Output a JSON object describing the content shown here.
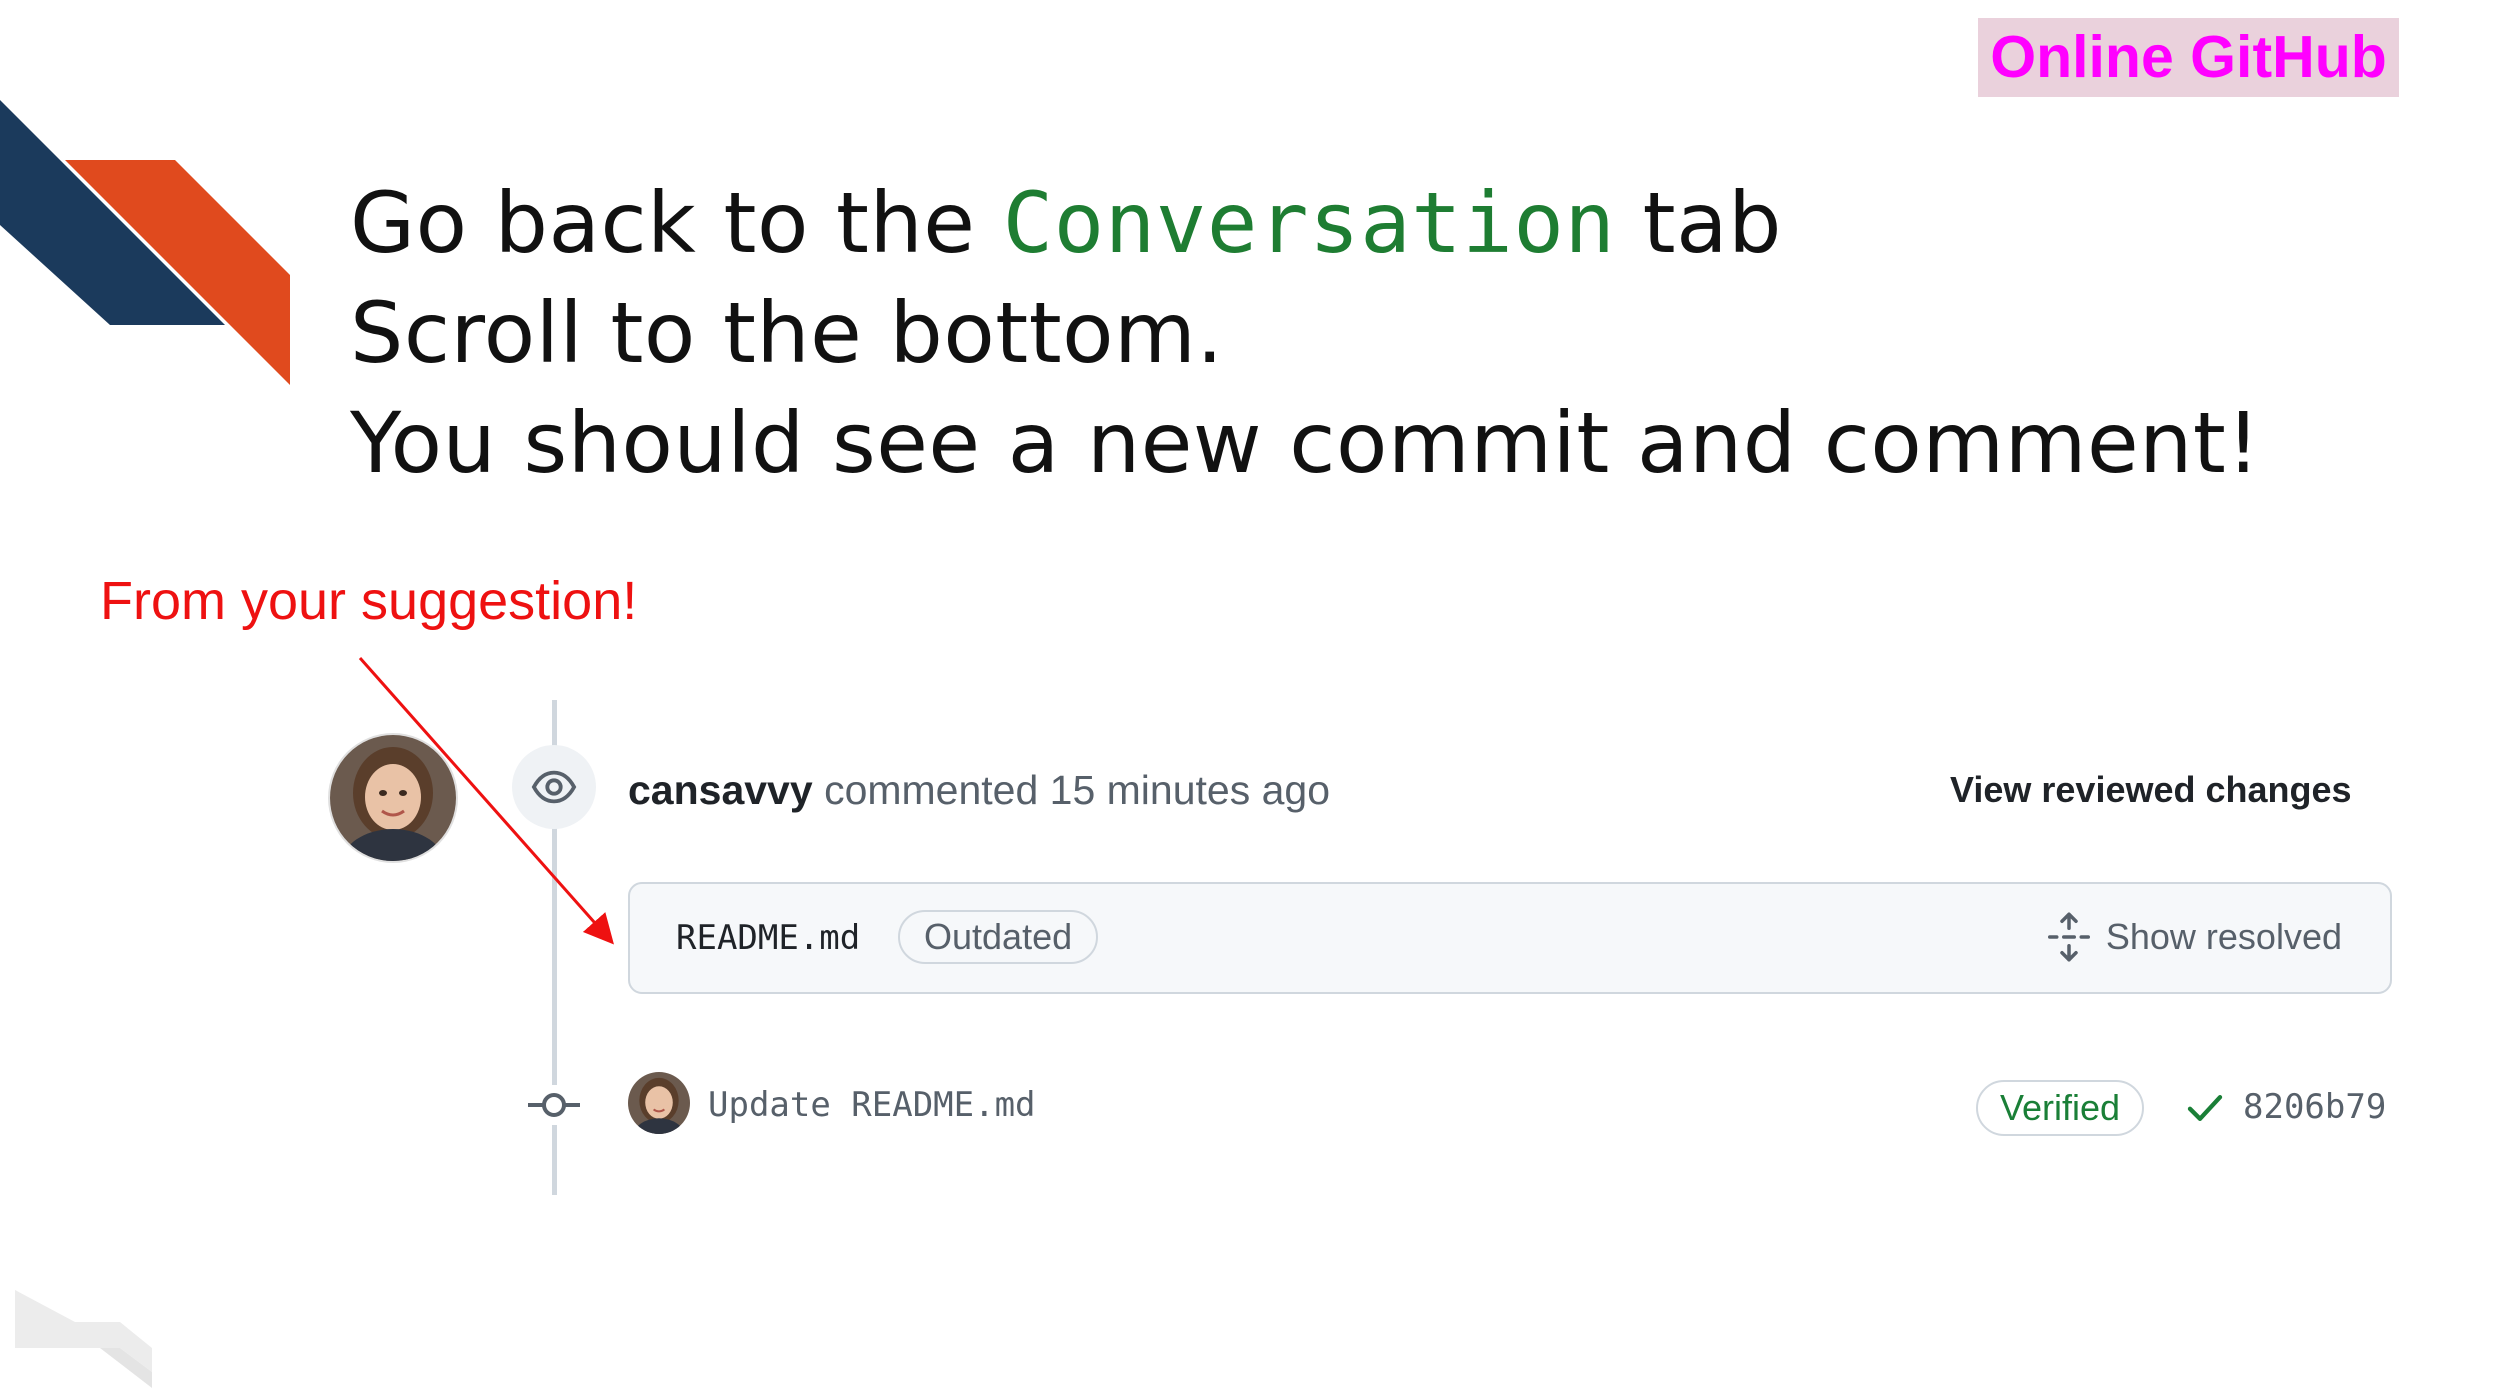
{
  "badge": {
    "label": "Online GitHub",
    "background": "#ead1dc",
    "color": "#ff00ff"
  },
  "heading": {
    "line1_before": "Go back to the ",
    "line1_code": "Conversation",
    "line1_after": " tab",
    "line2": "Scroll to the bottom.",
    "line3": "You should see a new commit and comment!"
  },
  "annotation": {
    "text": "From your suggestion!",
    "color": "#ee1111"
  },
  "review_comment": {
    "author": "cansavvy",
    "action": " commented 15 minutes ago",
    "icon": "eye-icon",
    "view_changes_label": "View reviewed changes",
    "file": {
      "name": "README.md",
      "status_label": "Outdated",
      "show_resolved_label": "Show resolved",
      "show_resolved_icon": "unfold-icon"
    }
  },
  "commit": {
    "icon": "git-commit-icon",
    "message": "Update README.md",
    "verified_label": "Verified",
    "status_icon": "check-icon",
    "sha": "8206b79"
  },
  "colors": {
    "code_green": "#1e7d32",
    "verified_green": "#1a7f37",
    "slide_navy": "#1b3a5c",
    "slide_orange": "#e04a1e",
    "muted_text": "#57606a",
    "border": "#d0d7de"
  }
}
